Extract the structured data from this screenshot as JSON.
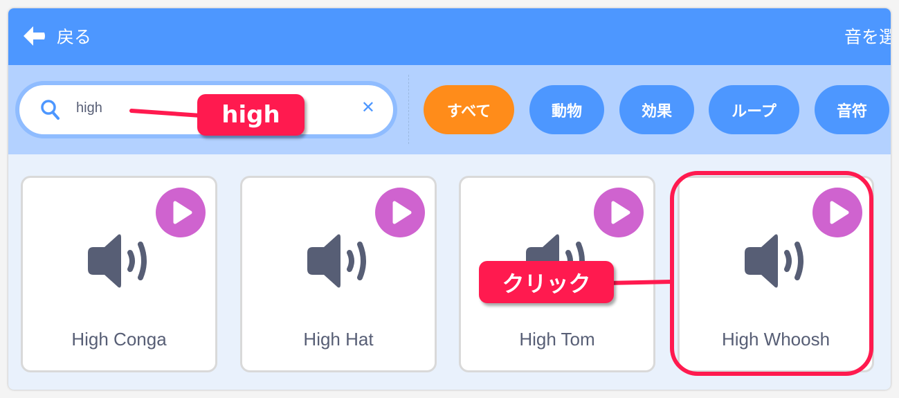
{
  "header": {
    "back_label": "戻る",
    "title": "音を選ぶ"
  },
  "search": {
    "value": "high"
  },
  "categories": [
    {
      "label": "すべて",
      "active": true
    },
    {
      "label": "動物",
      "active": false
    },
    {
      "label": "効果",
      "active": false
    },
    {
      "label": "ループ",
      "active": false
    },
    {
      "label": "音符",
      "active": false
    }
  ],
  "sounds": [
    {
      "name": "High Conga"
    },
    {
      "name": "High Hat"
    },
    {
      "name": "High Tom"
    },
    {
      "name": "High Whoosh"
    }
  ],
  "annotations": {
    "search_note": "high",
    "click_note": "クリック"
  },
  "colors": {
    "header": "#4d97ff",
    "filter_bar": "#b3d1ff",
    "active_chip": "#ff8c1a",
    "play": "#cf63cf",
    "annotation": "#ff1a4f"
  }
}
